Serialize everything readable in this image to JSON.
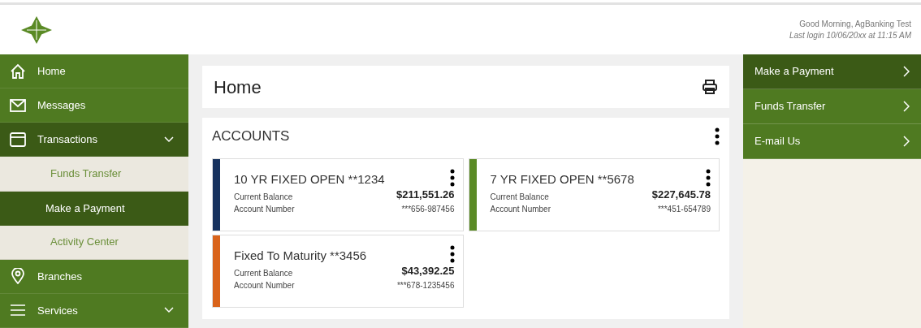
{
  "header": {
    "greeting": "Good Morning, AgBanking Test",
    "last_login": "Last login 10/06/20xx at 11:15 AM"
  },
  "sidebar": {
    "items": [
      {
        "label": "Home",
        "selected": false
      },
      {
        "label": "Messages",
        "selected": false
      },
      {
        "label": "Transactions",
        "selected": false,
        "expanded": true,
        "children": [
          {
            "label": "Funds Transfer",
            "selected": false
          },
          {
            "label": "Make a Payment",
            "selected": true
          },
          {
            "label": "Activity Center",
            "selected": false
          }
        ]
      },
      {
        "label": "Branches",
        "selected": false
      },
      {
        "label": "Services",
        "selected": false,
        "expanded": false
      }
    ]
  },
  "page": {
    "title": "Home"
  },
  "accounts": {
    "title": "ACCOUNTS",
    "cards": [
      {
        "name": "10 YR FIXED OPEN **1234",
        "balance_label": "Current Balance",
        "balance": "$211,551.26",
        "number_label": "Account Number",
        "number": "***656-987456",
        "color": "#17325e"
      },
      {
        "name": "7 YR FIXED OPEN **5678",
        "balance_label": "Current Balance",
        "balance": "$227,645.78",
        "number_label": "Account Number",
        "number": "***451-654789",
        "color": "#5a8a25"
      },
      {
        "name": "Fixed To Maturity **3456",
        "balance_label": "Current Balance",
        "balance": "$43,392.25",
        "number_label": "Account Number",
        "number": "***678-1235456",
        "color": "#d9631a"
      }
    ]
  },
  "quick_links": [
    {
      "label": "Make a Payment",
      "selected": true
    },
    {
      "label": "Funds Transfer",
      "selected": false
    },
    {
      "label": "E-mail Us",
      "selected": false
    }
  ]
}
